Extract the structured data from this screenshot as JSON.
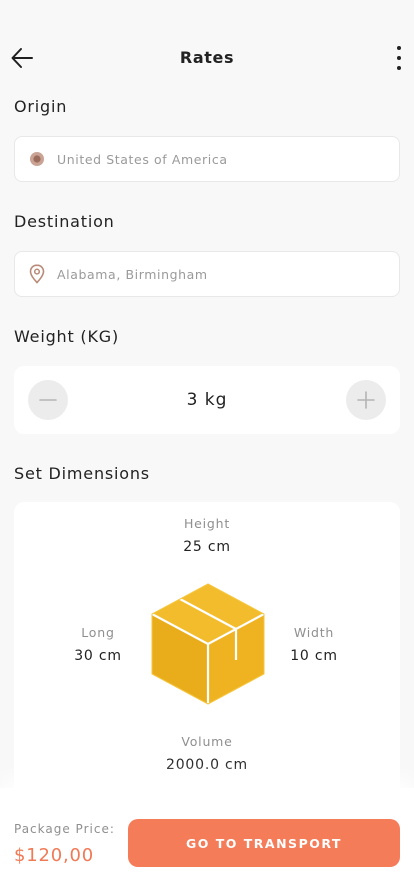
{
  "header": {
    "title": "Rates"
  },
  "origin": {
    "label": "Origin",
    "placeholder": "United States of America",
    "icon": "origin-dot-icon"
  },
  "destination": {
    "label": "Destination",
    "placeholder": "Alabama, Birmingham",
    "icon": "location-pin-icon"
  },
  "weight": {
    "label": "Weight (KG)",
    "value": "3 kg"
  },
  "dimensions": {
    "label": "Set Dimensions",
    "height_label": "Height",
    "height_value": "25 cm",
    "long_label": "Long",
    "long_value": "30 cm",
    "width_label": "Width",
    "width_value": "10 cm",
    "volume_label": "Volume",
    "volume_value": "2000.0 cm"
  },
  "footer": {
    "price_label": "Package Price:",
    "price_value": "$120,00",
    "button_label": "GO TO TRANSPORT"
  },
  "colors": {
    "accent": "#f47c59",
    "price": "#f07a55",
    "icon_brown": "#b98a78",
    "box_yellow": "#edb01f"
  }
}
